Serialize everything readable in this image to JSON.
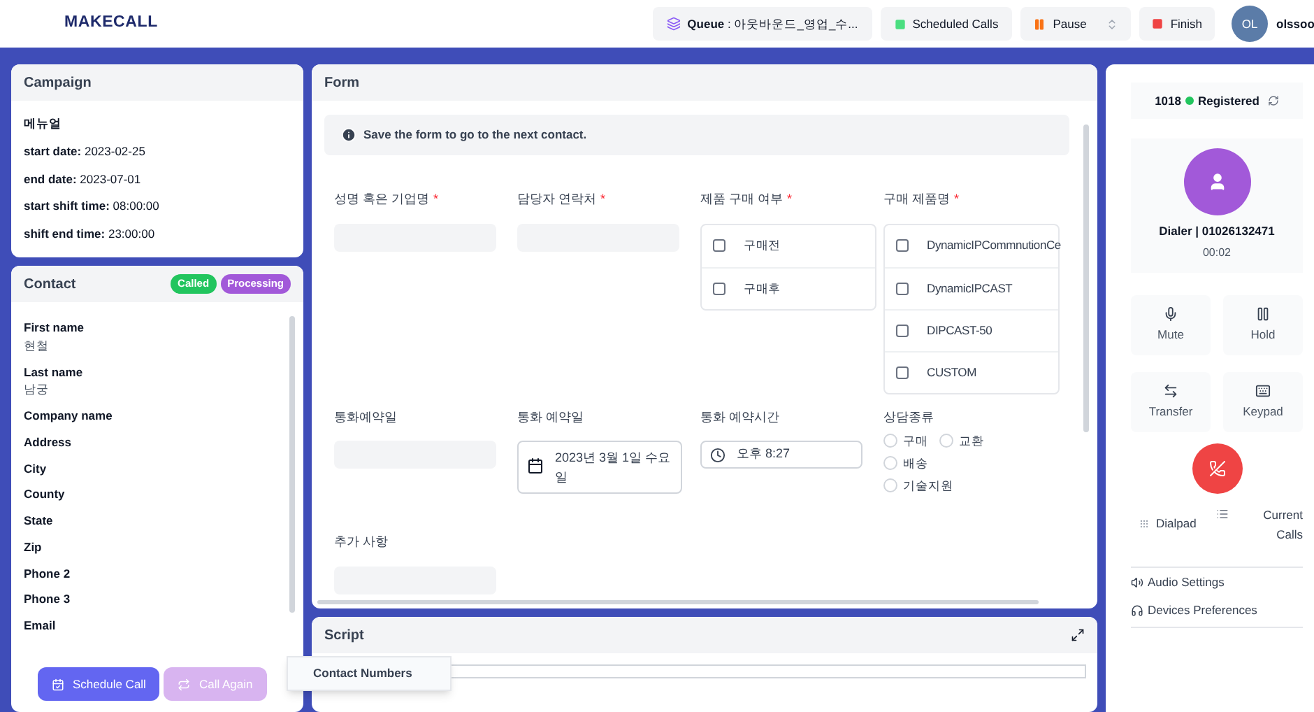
{
  "header": {
    "logo": "MAKECALL",
    "queue": {
      "label": "Queue",
      "value": ": 아웃바운드_영업_수..."
    },
    "scheduled": "Scheduled Calls",
    "pause": "Pause",
    "finish": "Finish",
    "avatar": "OL",
    "user": "olssoo"
  },
  "campaign": {
    "title": "Campaign",
    "name": "메뉴얼",
    "fields": [
      {
        "label": "start date:",
        "value": "2023-02-25"
      },
      {
        "label": "end date:",
        "value": "2023-07-01"
      },
      {
        "label": "start shift time:",
        "value": "08:00:00"
      },
      {
        "label": "shift end time:",
        "value": "23:00:00"
      }
    ]
  },
  "contact": {
    "title": "Contact",
    "badges": [
      {
        "text": "Called",
        "color": "#22c55e"
      },
      {
        "text": "Processing",
        "color": "#a259d9"
      }
    ],
    "fields": [
      {
        "label": "First name",
        "value": "현철"
      },
      {
        "label": "Last name",
        "value": "남궁"
      },
      {
        "label": "Company name"
      },
      {
        "label": "Address"
      },
      {
        "label": "City"
      },
      {
        "label": "County"
      },
      {
        "label": "State"
      },
      {
        "label": "Zip"
      },
      {
        "label": "Phone 2"
      },
      {
        "label": "Phone 3"
      },
      {
        "label": "Email"
      }
    ],
    "buttons": [
      {
        "text": "Schedule Call",
        "disabled": false
      },
      {
        "text": "Call Again",
        "disabled": true
      }
    ]
  },
  "form": {
    "title": "Form",
    "notice": "Save the form to go to the next contact.",
    "row1": [
      {
        "kind": "text",
        "label": "성명 혹은 기업명",
        "required_mark": "*"
      },
      {
        "kind": "text",
        "label": "담당자 연락처",
        "required_mark": "*"
      },
      {
        "kind": "checks",
        "label": "제품 구매 여부",
        "required_mark": "*",
        "options": [
          {
            "text": "구매전",
            "checked": false
          },
          {
            "text": "구매후",
            "checked": false
          }
        ]
      },
      {
        "kind": "checks",
        "label": "구매 제품명",
        "required_mark": "*",
        "options": [
          {
            "text": "DynamicIPCommnutionCe",
            "checked": false
          },
          {
            "text": "DynamicIPCAST",
            "checked": false
          },
          {
            "text": "DIPCAST-50",
            "checked": false
          },
          {
            "text": "CUSTOM",
            "checked": false
          }
        ]
      }
    ],
    "row2": [
      {
        "kind": "text",
        "label": "통화예약일"
      },
      {
        "kind": "date",
        "label": "통화 예약일",
        "value": "2023년 3월 1일 수요일"
      },
      {
        "kind": "time",
        "label": "통화 예약시간",
        "value": "오후 8:27"
      },
      {
        "kind": "radios",
        "label": "상담종류",
        "options": [
          {
            "text": "구매",
            "selected": false
          },
          {
            "text": "교환",
            "selected": false
          },
          {
            "text": "배송",
            "selected": false
          },
          {
            "text": "기술지원",
            "selected": false
          }
        ]
      }
    ],
    "row3": [
      {
        "kind": "text",
        "label": "추가 사항"
      }
    ]
  },
  "script": {
    "title": "Script"
  },
  "popup": "Contact Numbers",
  "phone": {
    "extension": "1018",
    "status": "Registered",
    "registered": true,
    "caller": "Dialer | 01026132471",
    "timer": "00:02",
    "controls": [
      {
        "kind": "mute",
        "text": "Mute"
      },
      {
        "kind": "hold",
        "text": "Hold"
      },
      {
        "kind": "transfer",
        "text": "Transfer"
      },
      {
        "kind": "keypad",
        "text": "Keypad"
      }
    ],
    "dialpad": "Dialpad",
    "current_calls": "Current Calls",
    "audio": "Audio Settings",
    "devices": "Devices Preferences"
  }
}
